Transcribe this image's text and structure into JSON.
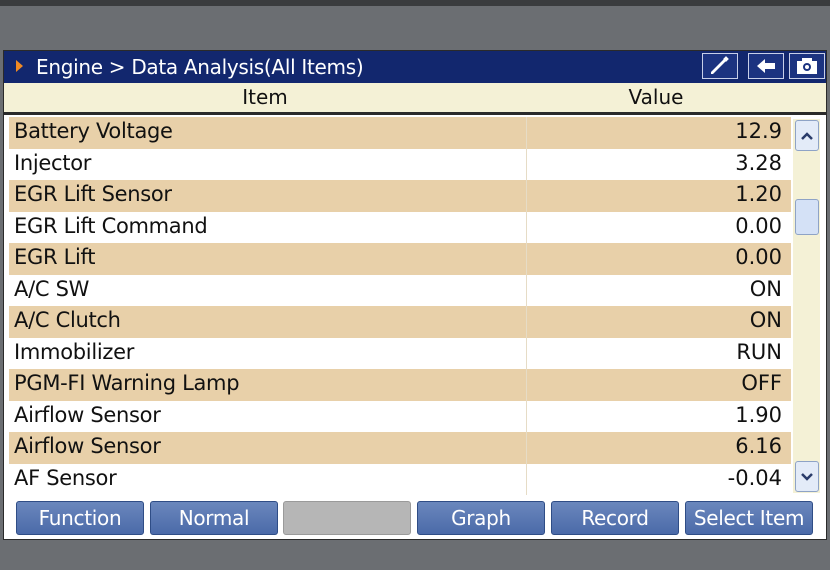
{
  "title": "Engine > Data Analysis(All Items)",
  "title_buttons": [
    {
      "icon": "pen-icon"
    },
    {
      "icon": "back-arrow-icon"
    },
    {
      "icon": "camera-icon"
    }
  ],
  "columns": {
    "item": "Item",
    "value": "Value"
  },
  "rows": [
    {
      "name": "Battery Voltage",
      "value": "12.9"
    },
    {
      "name": "Injector",
      "value": "3.28"
    },
    {
      "name": "EGR Lift Sensor",
      "value": "1.20"
    },
    {
      "name": "EGR Lift Command",
      "value": "0.00"
    },
    {
      "name": "EGR Lift",
      "value": "0.00"
    },
    {
      "name": "A/C SW",
      "value": "ON"
    },
    {
      "name": "A/C Clutch",
      "value": "ON"
    },
    {
      "name": "Immobilizer",
      "value": "RUN"
    },
    {
      "name": "PGM-FI Warning Lamp",
      "value": "OFF"
    },
    {
      "name": "Airflow Sensor",
      "value": "1.90"
    },
    {
      "name": "Airflow Sensor",
      "value": "6.16"
    },
    {
      "name": "AF Sensor",
      "value": "-0.04"
    }
  ],
  "scrollbar": {
    "up_icon": "chevron-up-icon",
    "down_icon": "chevron-down-icon"
  },
  "function_buttons": [
    "Function",
    "Normal",
    "",
    "Graph",
    "Record",
    "Select Item"
  ],
  "colors": {
    "title_bar": "#12276e",
    "row_alt": "#e8d0a9",
    "header_bg": "#f4f1d6",
    "button_blue": "#4b6aa8",
    "title_arrow": "#f08a24"
  }
}
